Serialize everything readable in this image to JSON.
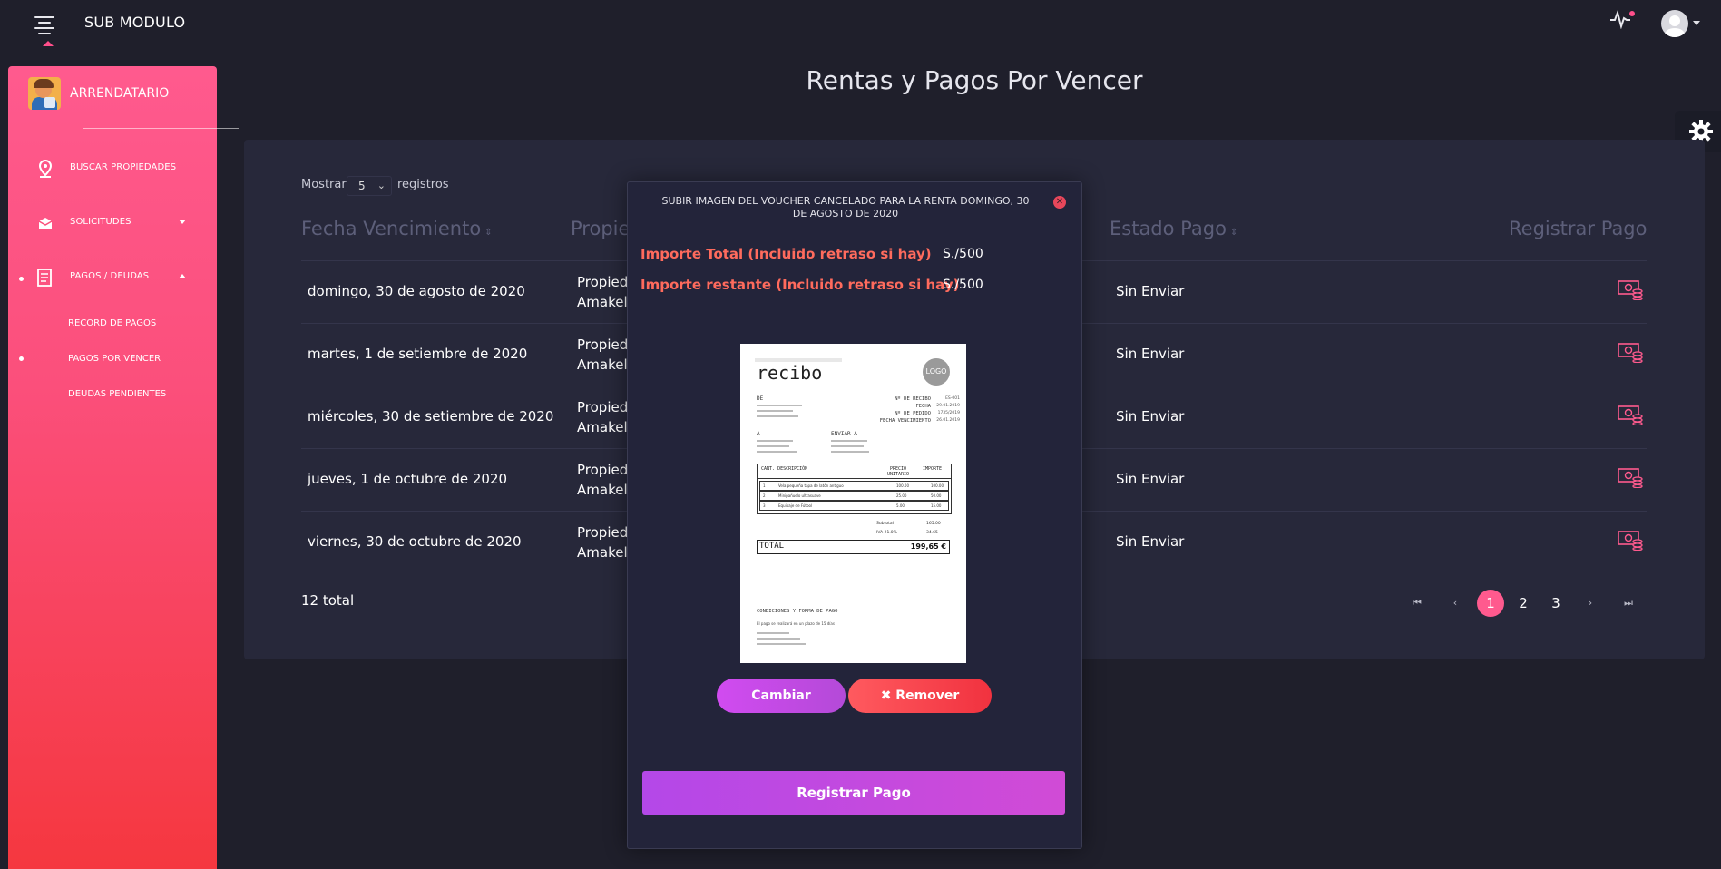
{
  "header": {
    "module_title": "SUB MODULO"
  },
  "sidebar": {
    "user": "ARRENDATARIO",
    "items": [
      {
        "label": "BUSCAR PROPIEDADES"
      },
      {
        "label": "SOLICITUDES"
      },
      {
        "label": "PAGOS / DEUDAS"
      }
    ],
    "subitems": [
      {
        "label": "RECORD DE PAGOS"
      },
      {
        "label": "PAGOS POR VENCER"
      },
      {
        "label": "DEUDAS PENDIENTES"
      }
    ]
  },
  "page": {
    "title": "Rentas y Pagos Por Vencer"
  },
  "table": {
    "show_prefix": "Mostrar",
    "show_value": "5",
    "show_suffix": "registros",
    "columns": [
      "Fecha Vencimiento",
      "Propiedad",
      "Estado Pago",
      "Registrar Pago"
    ],
    "rows": [
      {
        "fecha": "domingo, 30 de agosto de 2020",
        "propiedad_1": "Propiedad",
        "propiedad_2": "Amakella",
        "estado": "Sin Enviar"
      },
      {
        "fecha": "martes, 1 de setiembre de 2020",
        "propiedad_1": "Propiedad",
        "propiedad_2": "Amakella",
        "estado": "Sin Enviar"
      },
      {
        "fecha": "miércoles, 30 de setiembre de 2020",
        "propiedad_1": "Propiedad",
        "propiedad_2": "Amakella",
        "estado": "Sin Enviar"
      },
      {
        "fecha": "jueves, 1 de octubre de 2020",
        "propiedad_1": "Propiedad",
        "propiedad_2": "Amakella",
        "estado": "Sin Enviar"
      },
      {
        "fecha": "viernes, 30 de octubre de 2020",
        "propiedad_1": "Propiedad",
        "propiedad_2": "Amakella",
        "estado": "Sin Enviar"
      }
    ],
    "total": "12 total"
  },
  "pagination": {
    "pages": [
      "1",
      "2",
      "3"
    ],
    "current": "1"
  },
  "modal": {
    "title": "SUBIR IMAGEN DEL VOUCHER CANCELADO PARA LA RENTA DOMINGO, 30 DE AGOSTO DE 2020",
    "importe_total_label": "Importe Total (Incluido retraso si hay)",
    "importe_total_value": "S./500",
    "importe_restante_label": "Importe restante (Incluido retraso si hay)",
    "importe_restante_value": "S./500",
    "change_button": "Cambiar",
    "remove_button": "✖ Remover",
    "register_button": "Registrar Pago"
  },
  "voucher": {
    "title": "recibo",
    "logo": "LOGO",
    "from": "DE",
    "to_labels": [
      "A",
      "ENVIAR A"
    ],
    "meta": [
      "Nº DE RECIBO",
      "FECHA",
      "Nº DE PEDIDO",
      "FECHA VENCIMIENTO"
    ],
    "meta_values": [
      "ES-001",
      "29.01.2019",
      "1735/2019",
      "26.01.2019"
    ],
    "table_head": [
      "CANT.",
      "DESCRIPCIÓN",
      "PRECIO UNITARIO",
      "IMPORTE"
    ],
    "table_rows": [
      {
        "q": "1",
        "d": "Vela pequeña tapa de latón antiguo",
        "p": "100.00",
        "i": "100.00"
      },
      {
        "q": "2",
        "d": "Minipañuelo ultrasuave",
        "p": "25.00",
        "i": "50.00"
      },
      {
        "q": "3",
        "d": "Equipaje de Fútbol",
        "p": "5.00",
        "i": "15.00"
      }
    ],
    "subtotal_label": "Subtotal",
    "subtotal_value": "165.00",
    "tax_label": "IVA 21.0%",
    "tax_value": "34.65",
    "total_label": "TOTAL",
    "total_value": "199,65 €",
    "terms_title": "CONDICIONES Y FORMA DE PAGO",
    "terms_text": "El pago se realizará en un plazo de 15 días"
  }
}
